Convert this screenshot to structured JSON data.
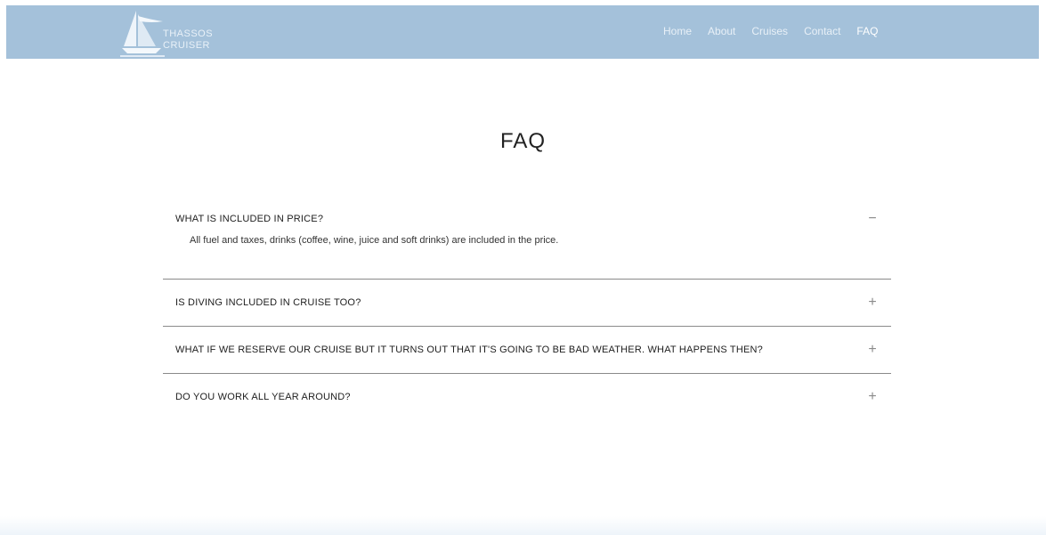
{
  "header": {
    "logo_line1": "THASSOS",
    "logo_line2": "CRUISER",
    "nav": [
      {
        "label": "Home"
      },
      {
        "label": "About"
      },
      {
        "label": "Cruises"
      },
      {
        "label": "Contact"
      },
      {
        "label": "FAQ"
      }
    ],
    "active_nav": "FAQ"
  },
  "main": {
    "title": "FAQ",
    "faq": [
      {
        "question": "WHAT IS INCLUDED IN PRICE?",
        "answer": "All fuel and taxes, drinks (coffee, wine, juice and soft drinks) are included in the price.",
        "expanded": true,
        "toggle": "−"
      },
      {
        "question": "IS DIVING INCLUDED IN CRUISE TOO?",
        "expanded": false,
        "toggle": "+"
      },
      {
        "question": "WHAT IF WE RESERVE OUR CRUISE BUT IT TURNS OUT THAT IT'S GOING TO BE BAD WEATHER. WHAT HAPPENS THEN?",
        "expanded": false,
        "toggle": "+"
      },
      {
        "question": "DO YOU WORK ALL YEAR AROUND?",
        "expanded": false,
        "toggle": "+"
      }
    ]
  },
  "colors": {
    "navbar": "#a4c1da",
    "nav_text": "#e8f0f7",
    "divider": "#8a8a8a"
  }
}
